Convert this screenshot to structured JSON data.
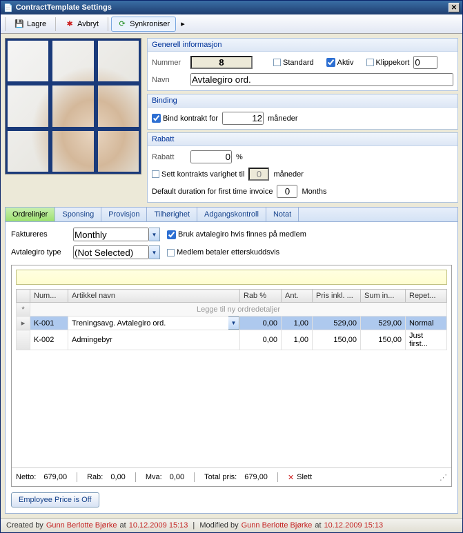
{
  "window": {
    "title": "ContractTemplate Settings"
  },
  "toolbar": {
    "save": "Lagre",
    "cancel": "Avbryt",
    "sync": "Synkroniser"
  },
  "general": {
    "title": "Generell informasjon",
    "number_label": "Nummer",
    "number": "8",
    "standard_label": "Standard",
    "aktiv_label": "Aktiv",
    "klippekort_label": "Klippekort",
    "klippekort_val": "0",
    "navn_label": "Navn",
    "navn": "Avtalegiro ord."
  },
  "binding": {
    "title": "Binding",
    "label": "Bind kontrakt for",
    "months": "12",
    "unit": "måneder"
  },
  "rabatt": {
    "title": "Rabatt",
    "label": "Rabatt",
    "value": "0",
    "pct": "%",
    "set_duration_label": "Sett kontrakts varighet til",
    "set_duration_val": "0",
    "set_duration_unit": "måneder",
    "default_dur_label": "Default duration for first time invoice",
    "default_dur_val": "0",
    "default_dur_unit": "Months"
  },
  "tabs": [
    "Ordrelinjer",
    "Sponsing",
    "Provisjon",
    "Tilhørighet",
    "Adgangskontroll",
    "Notat"
  ],
  "invoice": {
    "faktureres_label": "Faktureres",
    "faktureres": "Monthly",
    "avtalegiro_type_label": "Avtalegiro type",
    "avtalegiro_type": "(Not Selected)",
    "bruk_label": "Bruk avtalegiro hvis finnes på medlem",
    "medlem_label": "Medlem betaler etterskuddsvis"
  },
  "grid": {
    "cols": [
      "Num...",
      "Artikkel navn",
      "Rab %",
      "Ant.",
      "Pris inkl. ...",
      "Sum in...",
      "Repet..."
    ],
    "newrow": "Legge til ny ordredetaljer",
    "rows": [
      {
        "num": "K-001",
        "navn": "Treningsavg.  Avtalegiro ord.",
        "rab": "0,00",
        "ant": "1,00",
        "pris": "529,00",
        "sum": "529,00",
        "rep": "Normal",
        "sel": true
      },
      {
        "num": "K-002",
        "navn": "Admingebyr",
        "rab": "0,00",
        "ant": "1,00",
        "pris": "150,00",
        "sum": "150,00",
        "rep": "Just first..."
      }
    ]
  },
  "totals": {
    "netto_label": "Netto:",
    "netto": "679,00",
    "rab_label": "Rab:",
    "rab": "0,00",
    "mva_label": "Mva:",
    "mva": "0,00",
    "total_label": "Total pris:",
    "total": "679,00",
    "delete": "Slett"
  },
  "emp_btn": "Employee Price is Off",
  "status": {
    "created_by_label": "Created by",
    "created_by": "Gunn Berlotte Bjørke",
    "at": "at",
    "created_at": "10.12.2009 15:13",
    "modified_by_label": "Modified by",
    "modified_by": "Gunn Berlotte Bjørke",
    "modified_at": "10.12.2009 15:13"
  }
}
